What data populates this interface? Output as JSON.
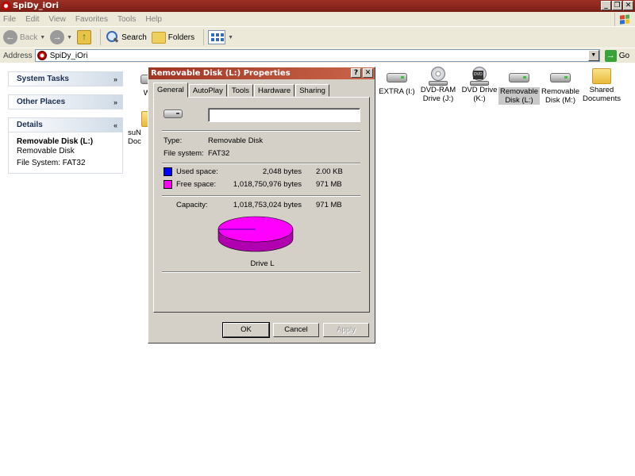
{
  "window": {
    "title": "SpiDy_iOri",
    "buttons": {
      "minimize": "_",
      "maximize": "❐",
      "close": "✕"
    }
  },
  "menubar": [
    "File",
    "Edit",
    "View",
    "Favorites",
    "Tools",
    "Help"
  ],
  "toolbar": {
    "back": "Back",
    "search": "Search",
    "folders": "Folders"
  },
  "address": {
    "label": "Address",
    "value": "SpiDy_iOri",
    "go": "Go"
  },
  "taskpane": {
    "system_tasks": "System Tasks",
    "other_places": "Other Places",
    "details": {
      "heading": "Details",
      "name": "Removable Disk (L:)",
      "type": "Removable Disk",
      "filesystem": "File System: FAT32"
    }
  },
  "items": [
    {
      "label": "WIN",
      "icon": "drive-icon"
    },
    {
      "label": "suN Doc",
      "icon": "folder-icon"
    },
    {
      "label": "EXTRA (I:)",
      "icon": "drive-icon"
    },
    {
      "label": "DVD-RAM Drive (J:)",
      "icon": "cd-drive-icon"
    },
    {
      "label": "DVD Drive (K:)",
      "icon": "dvd-drive-icon"
    },
    {
      "label": "Removable Disk (L:)",
      "icon": "removable-drive-icon"
    },
    {
      "label": "Removable Disk (M:)",
      "icon": "removable-drive-icon"
    },
    {
      "label": "Shared Documents",
      "icon": "folder-icon"
    }
  ],
  "dialog": {
    "title": "Removable Disk (L:) Properties",
    "title_buttons": {
      "help": "?",
      "close": "✕"
    },
    "tabs": [
      "General",
      "AutoPlay",
      "Tools",
      "Hardware",
      "Sharing"
    ],
    "name_value": "",
    "type_label": "Type:",
    "type_value": "Removable Disk",
    "fs_label": "File system:",
    "fs_value": "FAT32",
    "used_label": "Used space:",
    "used_bytes": "2,048 bytes",
    "used_human": "2.00 KB",
    "free_label": "Free space:",
    "free_bytes": "1,018,750,976 bytes",
    "free_human": "971 MB",
    "capacity_label": "Capacity:",
    "capacity_bytes": "1,018,753,024 bytes",
    "capacity_human": "971 MB",
    "drive_label": "Drive L",
    "used_fraction": 2e-06,
    "colors": {
      "used": "#0000ff",
      "free": "#ff00ff"
    },
    "buttons": {
      "ok": "OK",
      "cancel": "Cancel",
      "apply": "Apply"
    }
  }
}
